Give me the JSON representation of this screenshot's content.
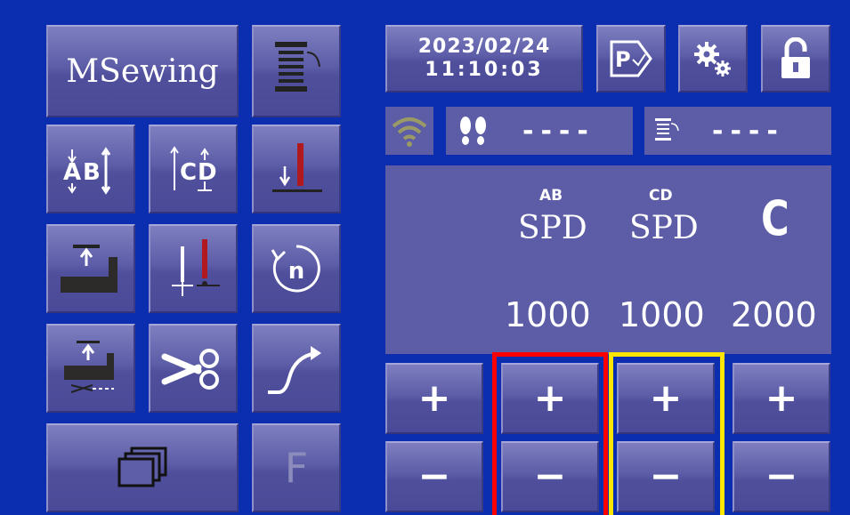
{
  "brand": {
    "label": "MSewing"
  },
  "clock": {
    "date": "2023/02/24",
    "time": "11:10:03"
  },
  "status": {
    "stitch_count": "----",
    "bobbin_count": "----"
  },
  "speeds": [
    {
      "top": "AB",
      "label": "SPD",
      "value": "1000"
    },
    {
      "top": "CD",
      "label": "SPD",
      "value": "1000"
    },
    {
      "top": "",
      "label": "C",
      "value": "2000"
    }
  ],
  "controls": {
    "plus": "+",
    "minus": "−",
    "f_key": "F"
  },
  "colors": {
    "highlight_red": "#ff0000",
    "highlight_yellow": "#ffe600",
    "panel": "#5d5da7",
    "background": "#0b2db0"
  }
}
